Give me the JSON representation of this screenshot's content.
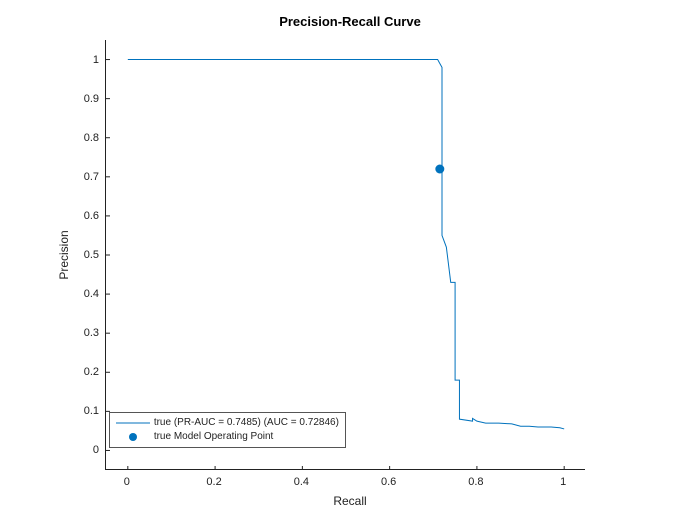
{
  "chart_data": {
    "type": "line",
    "title": "Precision-Recall Curve",
    "xlabel": "Recall",
    "ylabel": "Precision",
    "xlim": [
      -0.05,
      1.05
    ],
    "ylim": [
      -0.05,
      1.05
    ],
    "xticks": [
      0,
      0.2,
      0.4,
      0.6,
      0.8,
      1
    ],
    "yticks": [
      0,
      0.1,
      0.2,
      0.3,
      0.4,
      0.5,
      0.6,
      0.7,
      0.8,
      0.9,
      1
    ],
    "series": [
      {
        "name": "true (PR-AUC = 0.7485) (AUC = 0.72846)",
        "x": [
          0.0,
          0.04,
          0.71,
          0.715,
          0.72,
          0.72,
          0.73,
          0.74,
          0.75,
          0.75,
          0.76,
          0.76,
          0.79,
          0.79,
          0.8,
          0.82,
          0.85,
          0.88,
          0.9,
          0.92,
          0.94,
          0.97,
          0.99,
          1.0
        ],
        "y": [
          1.0,
          1.0,
          1.0,
          0.99,
          0.98,
          0.55,
          0.52,
          0.43,
          0.43,
          0.18,
          0.18,
          0.08,
          0.075,
          0.082,
          0.075,
          0.07,
          0.07,
          0.068,
          0.062,
          0.062,
          0.06,
          0.06,
          0.058,
          0.055
        ]
      }
    ],
    "markers": [
      {
        "name": "true Model Operating Point",
        "x": 0.715,
        "y": 0.72
      }
    ],
    "legend": {
      "position": "bottom-left-inside",
      "entries": [
        "true (PR-AUC = 0.7485) (AUC = 0.72846)",
        "true Model Operating Point"
      ]
    },
    "colors": {
      "line": "#0072BD",
      "marker": "#0072BD"
    }
  }
}
